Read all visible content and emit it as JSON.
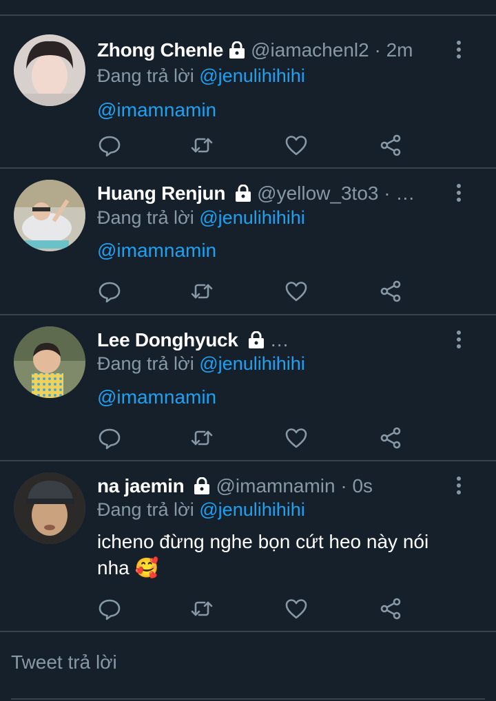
{
  "tweets": [
    {
      "name": "Zhong Chenle",
      "meta": "@iamachenl2 · 2m",
      "replying_prefix": "Đang trả lời ",
      "replying_to": "@jenulihihihi",
      "body": "@imamnamin",
      "body_is_mention": true
    },
    {
      "name": "Huang Renjun",
      "meta": "@yellow_3to3 · …",
      "replying_prefix": "Đang trả lời ",
      "replying_to": "@jenulihihihi",
      "body": "@imamnamin",
      "body_is_mention": true
    },
    {
      "name": "Lee Donghyuck",
      "meta": "…",
      "replying_prefix": "Đang trả lời ",
      "replying_to": "@jenulihihihi",
      "body": "@imamnamin",
      "body_is_mention": true
    },
    {
      "name": "na jaemin",
      "meta": "@imamnamin · 0s",
      "replying_prefix": "Đang trả lời ",
      "replying_to": "@jenulihihihi",
      "body": "icheno đừng nghe bọn cứt heo này nói nha 🥰",
      "body_is_mention": false
    }
  ],
  "reply_box": {
    "placeholder": "Tweet trả lời"
  },
  "colors": {
    "background": "#15202b",
    "divider": "#38444d",
    "secondary_text": "#8899a6",
    "accent": "#1da1f2"
  },
  "icons": [
    "lock-icon",
    "more-icon",
    "reply-icon",
    "retweet-icon",
    "like-icon",
    "share-icon"
  ]
}
